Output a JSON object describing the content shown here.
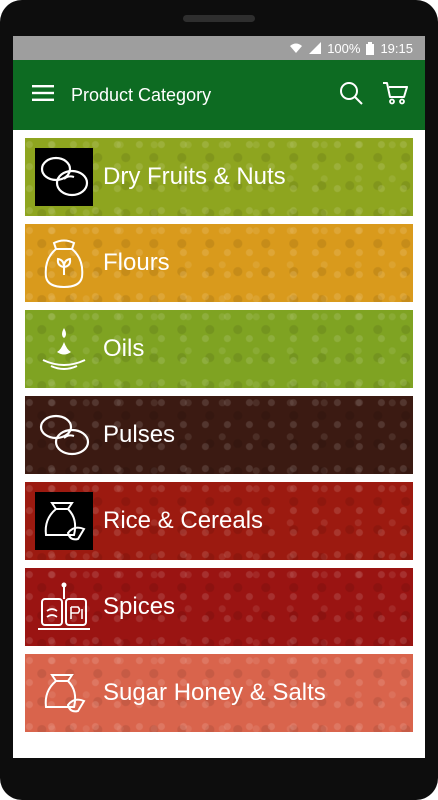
{
  "status": {
    "battery": "100%",
    "time": "19:15"
  },
  "appbar": {
    "title": "Product Category",
    "menu_icon": "menu-icon",
    "search_icon": "search-icon",
    "cart_icon": "cart-icon"
  },
  "categories": [
    {
      "label": "Dry Fruits & Nuts",
      "icon": "beans-icon",
      "color": "#8ea51f"
    },
    {
      "label": "Flours",
      "icon": "flour-sack-icon",
      "color": "#d99a1c"
    },
    {
      "label": "Oils",
      "icon": "oil-drop-icon",
      "color": "#7fa322"
    },
    {
      "label": "Pulses",
      "icon": "beans-icon",
      "color": "#3b1a12"
    },
    {
      "label": "Rice & Cereals",
      "icon": "rice-scoop-icon",
      "color": "#9c1a10"
    },
    {
      "label": "Spices",
      "icon": "spice-jars-icon",
      "color": "#9a1412"
    },
    {
      "label": "Sugar Honey & Salts",
      "icon": "sugar-scoop-icon",
      "color": "#d9644c"
    }
  ]
}
